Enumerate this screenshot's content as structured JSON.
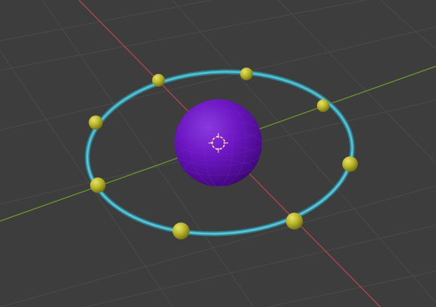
{
  "viewport": {
    "colors": {
      "background": "#3d3d3d",
      "grid_line": "#484848",
      "x_axis": "#b8464f",
      "y_axis": "#6e9b2b",
      "ring": "#3fa7b9",
      "ring_highlight": "#7fd3e0",
      "bead": "#b9b62a",
      "sphere": "#6a15b8",
      "origin_ring": "#ffffff",
      "origin_dash": "#e0305a"
    },
    "objects": {
      "sphere_label": "",
      "ring_label": ""
    }
  }
}
